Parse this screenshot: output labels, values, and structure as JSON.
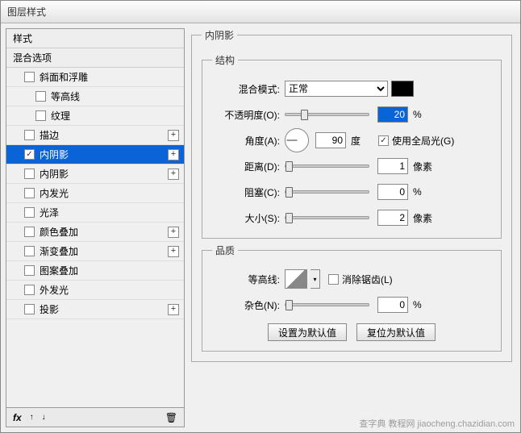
{
  "window": {
    "title": "图层样式"
  },
  "left": {
    "header_styles": "样式",
    "header_blend": "混合选项",
    "items": [
      {
        "label": "斜面和浮雕",
        "checked": false,
        "plus": false,
        "indent": 1
      },
      {
        "label": "等高线",
        "checked": false,
        "plus": false,
        "indent": 2
      },
      {
        "label": "纹理",
        "checked": false,
        "plus": false,
        "indent": 2
      },
      {
        "label": "描边",
        "checked": false,
        "plus": true,
        "indent": 1
      },
      {
        "label": "内阴影",
        "checked": true,
        "plus": true,
        "indent": 1,
        "selected": true
      },
      {
        "label": "内阴影",
        "checked": false,
        "plus": true,
        "indent": 1
      },
      {
        "label": "内发光",
        "checked": false,
        "plus": false,
        "indent": 1
      },
      {
        "label": "光泽",
        "checked": false,
        "plus": false,
        "indent": 1
      },
      {
        "label": "颜色叠加",
        "checked": false,
        "plus": true,
        "indent": 1
      },
      {
        "label": "渐变叠加",
        "checked": false,
        "plus": true,
        "indent": 1
      },
      {
        "label": "图案叠加",
        "checked": false,
        "plus": false,
        "indent": 1
      },
      {
        "label": "外发光",
        "checked": false,
        "plus": false,
        "indent": 1
      },
      {
        "label": "投影",
        "checked": false,
        "plus": true,
        "indent": 1
      }
    ],
    "footer": {
      "fx": "fx",
      "up": "↑",
      "down": "↓",
      "trash": "🗑"
    }
  },
  "panel": {
    "title": "内阴影",
    "structure": {
      "legend": "结构",
      "blend_mode_label": "混合模式:",
      "blend_mode_value": "正常",
      "opacity_label": "不透明度(O):",
      "opacity_value": "20",
      "opacity_unit": "%",
      "angle_label": "角度(A):",
      "angle_value": "90",
      "angle_unit": "度",
      "global_light_label": "使用全局光(G)",
      "global_light_checked": true,
      "distance_label": "距离(D):",
      "distance_value": "1",
      "distance_unit": "像素",
      "choke_label": "阻塞(C):",
      "choke_value": "0",
      "choke_unit": "%",
      "size_label": "大小(S):",
      "size_value": "2",
      "size_unit": "像素"
    },
    "quality": {
      "legend": "品质",
      "contour_label": "等高线:",
      "antialias_label": "消除锯齿(L)",
      "noise_label": "杂色(N):",
      "noise_value": "0",
      "noise_unit": "%"
    },
    "buttons": {
      "make_default": "设置为默认值",
      "reset_default": "复位为默认值"
    }
  },
  "watermark": "查字典  教程网  jiaocheng.chazidian.com"
}
